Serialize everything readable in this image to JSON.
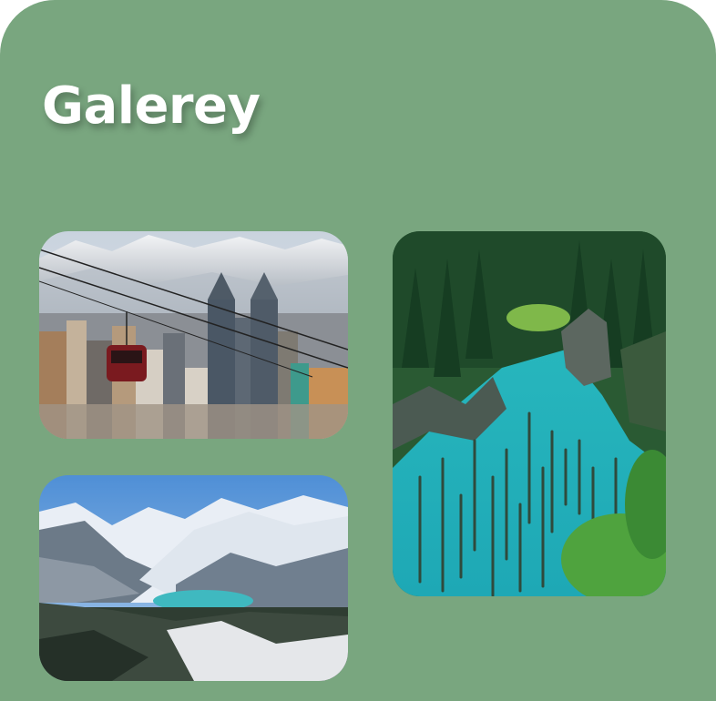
{
  "gallery": {
    "title": "Galerey",
    "photos": [
      {
        "subject": "city-skyline-cable-car"
      },
      {
        "subject": "mountain-lake-snowy-peaks"
      },
      {
        "subject": "turquoise-lake-forest"
      }
    ]
  }
}
